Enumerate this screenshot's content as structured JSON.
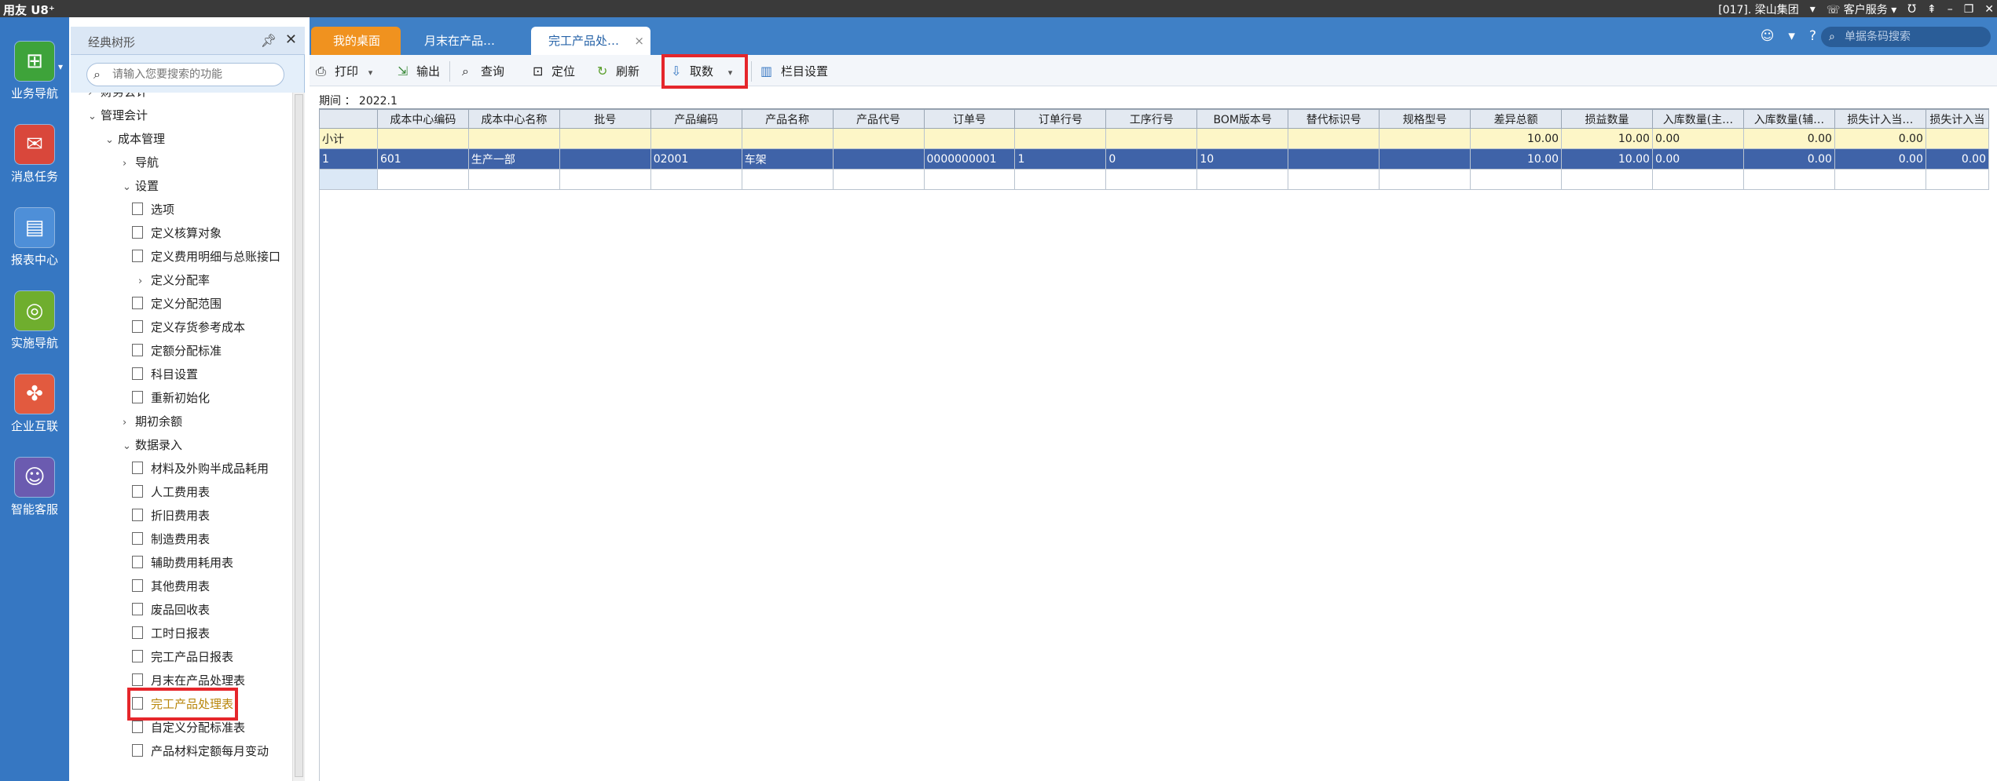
{
  "titlebar": {
    "logo": "用友 U8⁺",
    "account": "[017]. 梁山集团",
    "service": "客户服务",
    "icons": [
      "dropdown-icon",
      "service-icon",
      "u-icon",
      "pin-icon",
      "minimize-icon",
      "restore-icon",
      "close-icon"
    ]
  },
  "rail": {
    "items": [
      {
        "label": "业务导航",
        "icon": "business-nav-icon"
      },
      {
        "label": "消息任务",
        "icon": "message-icon"
      },
      {
        "label": "报表中心",
        "icon": "report-icon"
      },
      {
        "label": "实施导航",
        "icon": "compass-icon"
      },
      {
        "label": "企业互联",
        "icon": "connect-icon"
      },
      {
        "label": "智能客服",
        "icon": "support-icon"
      }
    ]
  },
  "tree": {
    "title": "经典树形",
    "search_placeholder": "请输入您要搜索的功能",
    "nodes": [
      {
        "label": "财务会计",
        "level": 0,
        "arrow": "›"
      },
      {
        "label": "管理会计",
        "level": 0,
        "arrow": "⌄"
      },
      {
        "label": "成本管理",
        "level": 1,
        "arrow": "⌄"
      },
      {
        "label": "导航",
        "level": 2,
        "arrow": "›"
      },
      {
        "label": "设置",
        "level": 2,
        "arrow": "⌄"
      },
      {
        "label": "选项",
        "level": 3,
        "doc": true
      },
      {
        "label": "定义核算对象",
        "level": 3,
        "doc": true
      },
      {
        "label": "定义费用明细与总账接口",
        "level": 3,
        "doc": true
      },
      {
        "label": "定义分配率",
        "level": 3,
        "arrow": "›"
      },
      {
        "label": "定义分配范围",
        "level": 3,
        "doc": true
      },
      {
        "label": "定义存货参考成本",
        "level": 3,
        "doc": true
      },
      {
        "label": "定额分配标准",
        "level": 3,
        "doc": true
      },
      {
        "label": "科目设置",
        "level": 3,
        "doc": true
      },
      {
        "label": "重新初始化",
        "level": 3,
        "doc": true
      },
      {
        "label": "期初余额",
        "level": 2,
        "arrow": "›"
      },
      {
        "label": "数据录入",
        "level": 2,
        "arrow": "⌄"
      },
      {
        "label": "材料及外购半成品耗用",
        "level": 3,
        "doc": true
      },
      {
        "label": "人工费用表",
        "level": 3,
        "doc": true
      },
      {
        "label": "折旧费用表",
        "level": 3,
        "doc": true
      },
      {
        "label": "制造费用表",
        "level": 3,
        "doc": true
      },
      {
        "label": "辅助费用耗用表",
        "level": 3,
        "doc": true
      },
      {
        "label": "其他费用表",
        "level": 3,
        "doc": true
      },
      {
        "label": "废品回收表",
        "level": 3,
        "doc": true
      },
      {
        "label": "工时日报表",
        "level": 3,
        "doc": true
      },
      {
        "label": "完工产品日报表",
        "level": 3,
        "doc": true
      },
      {
        "label": "月末在产品处理表",
        "level": 3,
        "doc": true
      },
      {
        "label": "完工产品处理表",
        "level": 3,
        "doc": true,
        "selected": true
      },
      {
        "label": "自定义分配标准表",
        "level": 3,
        "doc": true
      },
      {
        "label": "产品材料定额每月变动",
        "level": 3,
        "doc": true
      }
    ]
  },
  "tabs": {
    "home": "我的桌面",
    "t2": "月末在产品…",
    "active": "完工产品处…",
    "close": "×",
    "search_placeholder": "单据条码搜索"
  },
  "toolbar": {
    "print": "打印",
    "export": "输出",
    "query": "查询",
    "locate": "定位",
    "refresh": "刷新",
    "fetch": "取数",
    "columns": "栏目设置"
  },
  "period": {
    "label": "期间",
    "value": "2022.1"
  },
  "grid": {
    "columns": [
      "",
      "成本中心编码",
      "成本中心名称",
      "批号",
      "产品编码",
      "产品名称",
      "产品代号",
      "订单号",
      "订单行号",
      "工序行号",
      "BOM版本号",
      "替代标识号",
      "规格型号",
      "差异总额",
      "损益数量",
      "入库数量(主…",
      "入库数量(辅…",
      "损失计入当…",
      "损失计入当"
    ],
    "subtotal": [
      "小计",
      "",
      "",
      "",
      "",
      "",
      "",
      "",
      "",
      "",
      "",
      "",
      "",
      "10.00",
      "10.00",
      "0.00",
      "0.00",
      "0.00",
      ""
    ],
    "rows": [
      [
        "1",
        "601",
        "生产一部",
        "",
        "02001",
        "车架",
        "",
        "0000000001",
        "1",
        "0",
        "10",
        "",
        "",
        "10.00",
        "10.00",
        "0.00",
        "0.00",
        "0.00",
        "0.00"
      ]
    ]
  }
}
